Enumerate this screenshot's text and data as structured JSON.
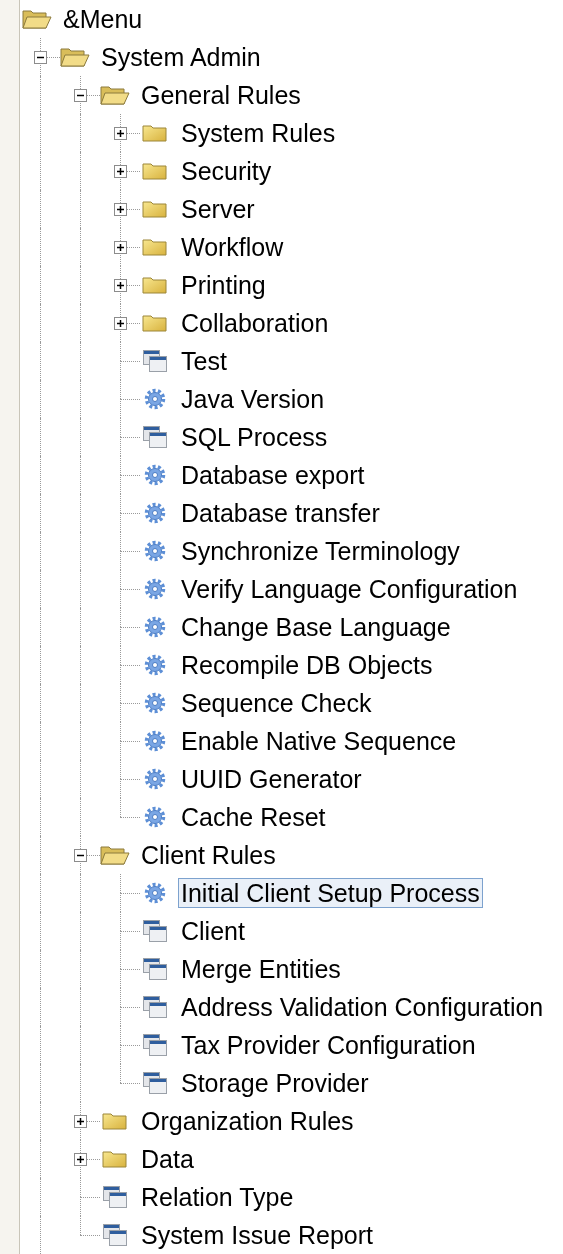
{
  "tree": {
    "root": {
      "label": "&Menu",
      "kind": "folder",
      "expanded": true,
      "selected": false,
      "children": [
        {
          "label": "System Admin",
          "kind": "folder",
          "expanded": true,
          "selected": false,
          "children": [
            {
              "label": "General Rules",
              "kind": "folder",
              "expanded": true,
              "selected": false,
              "children": [
                {
                  "label": "System Rules",
                  "kind": "folder",
                  "expanded": false,
                  "selected": false
                },
                {
                  "label": "Security",
                  "kind": "folder",
                  "expanded": false,
                  "selected": false
                },
                {
                  "label": "Server",
                  "kind": "folder",
                  "expanded": false,
                  "selected": false
                },
                {
                  "label": "Workflow",
                  "kind": "folder",
                  "expanded": false,
                  "selected": false
                },
                {
                  "label": "Printing",
                  "kind": "folder",
                  "expanded": false,
                  "selected": false
                },
                {
                  "label": "Collaboration",
                  "kind": "folder",
                  "expanded": false,
                  "selected": false
                },
                {
                  "label": "Test",
                  "kind": "window",
                  "selected": false
                },
                {
                  "label": "Java Version",
                  "kind": "process",
                  "selected": false
                },
                {
                  "label": "SQL Process",
                  "kind": "window",
                  "selected": false
                },
                {
                  "label": "Database export",
                  "kind": "process",
                  "selected": false
                },
                {
                  "label": "Database transfer",
                  "kind": "process",
                  "selected": false
                },
                {
                  "label": "Synchronize Terminology",
                  "kind": "process",
                  "selected": false
                },
                {
                  "label": "Verify Language Configuration",
                  "kind": "process",
                  "selected": false
                },
                {
                  "label": "Change Base Language",
                  "kind": "process",
                  "selected": false
                },
                {
                  "label": "Recompile DB Objects",
                  "kind": "process",
                  "selected": false
                },
                {
                  "label": "Sequence Check",
                  "kind": "process",
                  "selected": false
                },
                {
                  "label": "Enable Native Sequence",
                  "kind": "process",
                  "selected": false
                },
                {
                  "label": "UUID Generator",
                  "kind": "process",
                  "selected": false
                },
                {
                  "label": "Cache Reset",
                  "kind": "process",
                  "selected": false
                }
              ]
            },
            {
              "label": "Client Rules",
              "kind": "folder",
              "expanded": true,
              "selected": false,
              "children": [
                {
                  "label": "Initial Client Setup Process",
                  "kind": "process",
                  "selected": true
                },
                {
                  "label": "Client",
                  "kind": "window",
                  "selected": false
                },
                {
                  "label": "Merge Entities",
                  "kind": "window",
                  "selected": false
                },
                {
                  "label": "Address Validation Configuration",
                  "kind": "window",
                  "selected": false
                },
                {
                  "label": "Tax Provider Configuration",
                  "kind": "window",
                  "selected": false
                },
                {
                  "label": "Storage Provider",
                  "kind": "window",
                  "selected": false
                }
              ]
            },
            {
              "label": "Organization Rules",
              "kind": "folder",
              "expanded": false,
              "selected": false
            },
            {
              "label": "Data",
              "kind": "folder",
              "expanded": false,
              "selected": false
            },
            {
              "label": "Relation Type",
              "kind": "window",
              "selected": false
            },
            {
              "label": "System Issue Report",
              "kind": "window",
              "selected": false
            }
          ]
        }
      ]
    }
  }
}
